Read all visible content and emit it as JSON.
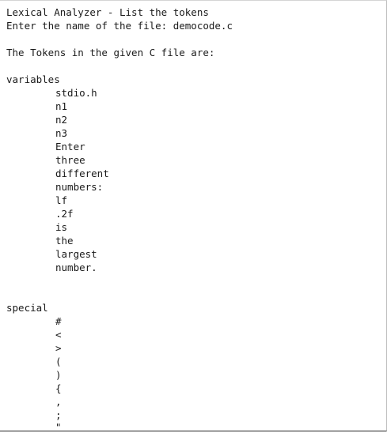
{
  "console": {
    "title_line": "Lexical Analyzer - List the tokens",
    "prompt_line": "Enter the name of the file: democode.c",
    "result_header": "The Tokens in the given C file are:",
    "sections": [
      {
        "heading": "variables",
        "tokens": [
          "stdio.h",
          "n1",
          "n2",
          "n3",
          "Enter",
          "three",
          "different",
          "numbers:",
          "lf",
          ".2f",
          "is",
          "the",
          "largest",
          "number."
        ]
      },
      {
        "heading": "special",
        "tokens": [
          "#",
          "<",
          ">",
          "(",
          ")",
          "{",
          ",",
          ";",
          "\""
        ]
      }
    ]
  }
}
